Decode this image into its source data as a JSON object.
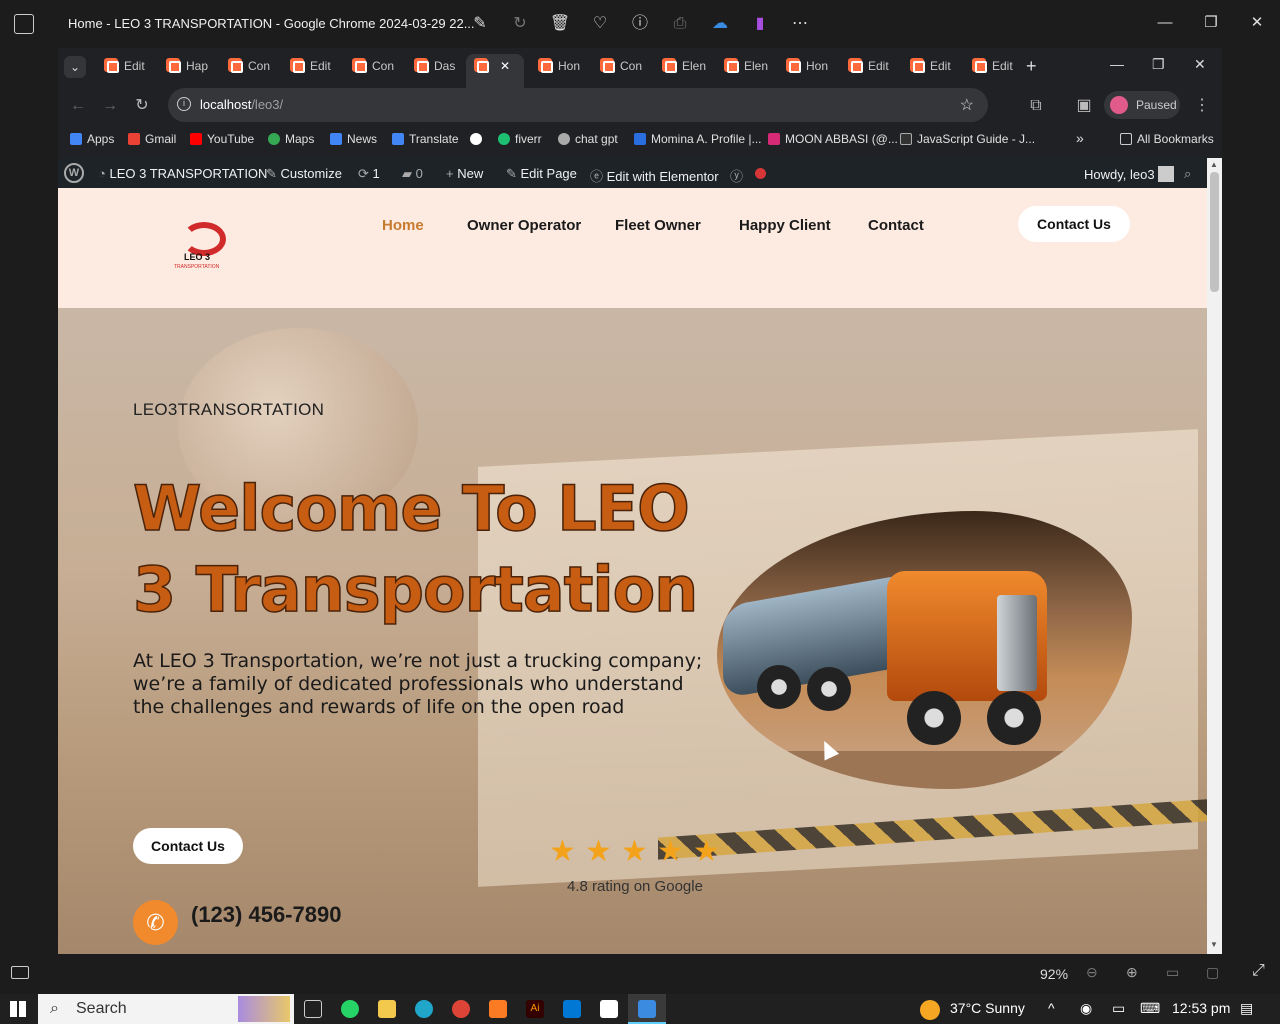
{
  "window": {
    "title": "Home - LEO 3 TRANSPORTATION - Google Chrome 2024-03-29 22...",
    "controls": [
      "—",
      "❐",
      "✕"
    ]
  },
  "viewer": {
    "zoom": "92%"
  },
  "browser": {
    "tabs": [
      {
        "label": "Edit"
      },
      {
        "label": "Hap"
      },
      {
        "label": "Con"
      },
      {
        "label": "Edit"
      },
      {
        "label": "Con"
      },
      {
        "label": "Das"
      },
      {
        "label": ""
      },
      {
        "label": "Hon"
      },
      {
        "label": "Con"
      },
      {
        "label": "Elen"
      },
      {
        "label": "Elen"
      },
      {
        "label": "Hon"
      },
      {
        "label": "Edit"
      },
      {
        "label": "Edit"
      },
      {
        "label": "Edit"
      }
    ],
    "address_host": "localhost",
    "address_path": "/leo3/",
    "profile_label": "Paused",
    "bookmarks": [
      "Apps",
      "Gmail",
      "YouTube",
      "Maps",
      "News",
      "Translate",
      "fiverr",
      "chat gpt",
      "Momina A. Profile |...",
      "MOON ABBASI (@...",
      "JavaScript Guide - J..."
    ],
    "all_bookmarks": "All Bookmarks"
  },
  "wp_admin": {
    "site": "LEO 3 TRANSPORTATION",
    "customize": "Customize",
    "updates": "1",
    "comments": "0",
    "new": "New",
    "edit_page": "Edit Page",
    "elementor": "Edit with Elementor",
    "howdy": "Howdy, leo3"
  },
  "site": {
    "logo_text": "LEO 3",
    "logo_sub": "TRANSPORTATION",
    "menu": [
      "Home",
      "Owner Operator",
      "Fleet Owner",
      "Happy Client",
      "Contact"
    ],
    "header_cta": "Contact Us",
    "hero": {
      "eyebrow": "LEO3TRANSORTATION",
      "title": "Welcome To LEO 3 Transportation",
      "paragraph": "At LEO 3 Transportation, we’re not just a trucking company; we’re a family of dedicated professionals who understand the challenges and rewards of life on the open road",
      "cta": "Contact Us",
      "rating_text": "4.8 rating on Google",
      "stars": 5,
      "phone": "(123) 456-7890"
    }
  },
  "taskbar": {
    "search": "Search",
    "weather": "37°C  Sunny",
    "time": "12:53 pm"
  },
  "colors": {
    "accent_orange": "#c65d12",
    "header_bg": "#fdebe1",
    "active_menu": "#c77b30"
  }
}
